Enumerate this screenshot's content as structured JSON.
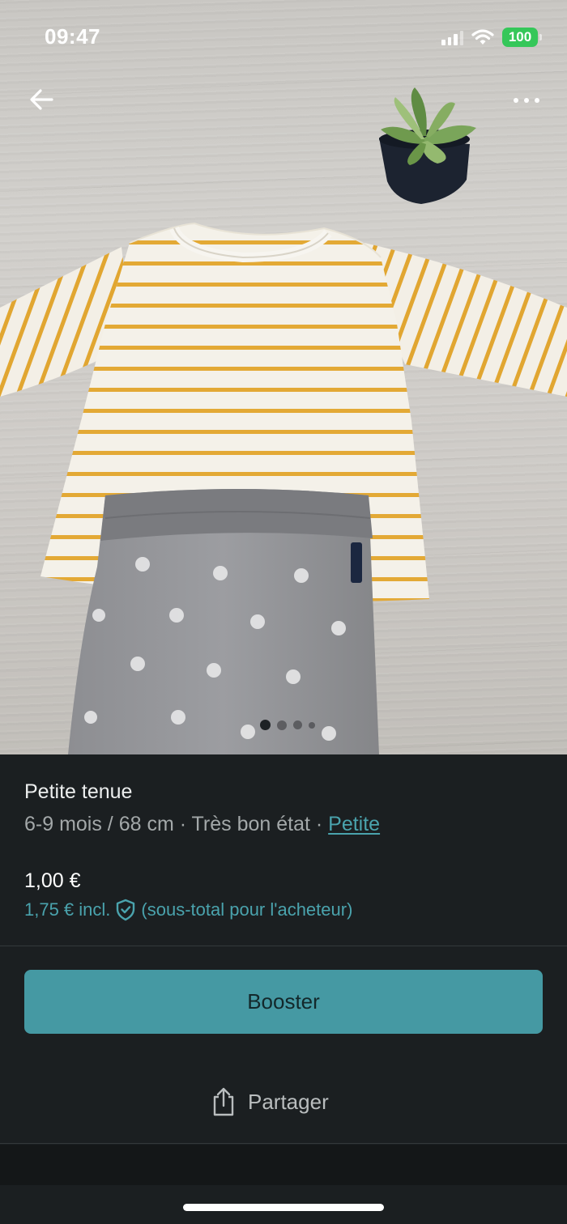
{
  "status_bar": {
    "time": "09:47",
    "battery": "100",
    "icons": [
      "signal-icon",
      "wifi-icon",
      "battery-icon"
    ]
  },
  "top_nav": {
    "back_icon": "arrow-left-icon",
    "more_icon": "more-horizontal-icon"
  },
  "gallery": {
    "photo_count": 4,
    "active_index": 0
  },
  "item": {
    "title": "Petite tenue",
    "size": "6-9 mois / 68 cm",
    "separator": " · ",
    "condition": "Très bon état",
    "brand": "Petite",
    "price": "1,00 €",
    "price_incl": "1,75 € incl.",
    "price_incl_note": "(sous-total pour l'acheteur)",
    "protection_icon": "shield-check-icon"
  },
  "actions": {
    "booster_label": "Booster",
    "share_label": "Partager",
    "share_icon": "share-icon"
  },
  "colors": {
    "background": "#1b1f21",
    "accent": "#4599a3",
    "link": "#4aa3ad",
    "battery": "#35c759"
  }
}
